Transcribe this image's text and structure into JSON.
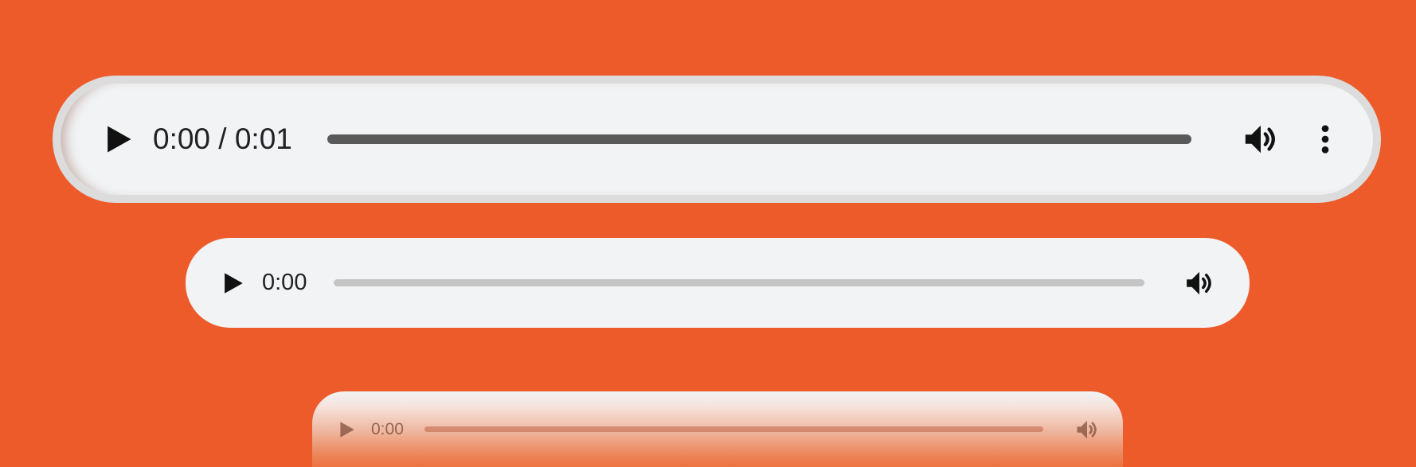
{
  "players": [
    {
      "id": "large",
      "time_label": "0:00 / 0:01",
      "progress": 0,
      "icons": {
        "play": "play-icon",
        "volume": "volume-icon",
        "more": "more-vertical-icon"
      }
    },
    {
      "id": "medium",
      "time_label": "0:00",
      "progress": 0,
      "icons": {
        "play": "play-icon",
        "volume": "volume-icon"
      }
    },
    {
      "id": "small",
      "time_label": "0:00",
      "progress": 0,
      "icons": {
        "play": "play-icon",
        "volume": "volume-icon"
      }
    }
  ],
  "colors": {
    "page_background": "#ed5b2b",
    "player_background": "#f1f3f4",
    "icon": "#111111",
    "track_active": "#595959",
    "track_idle": "#c4c4c4"
  }
}
